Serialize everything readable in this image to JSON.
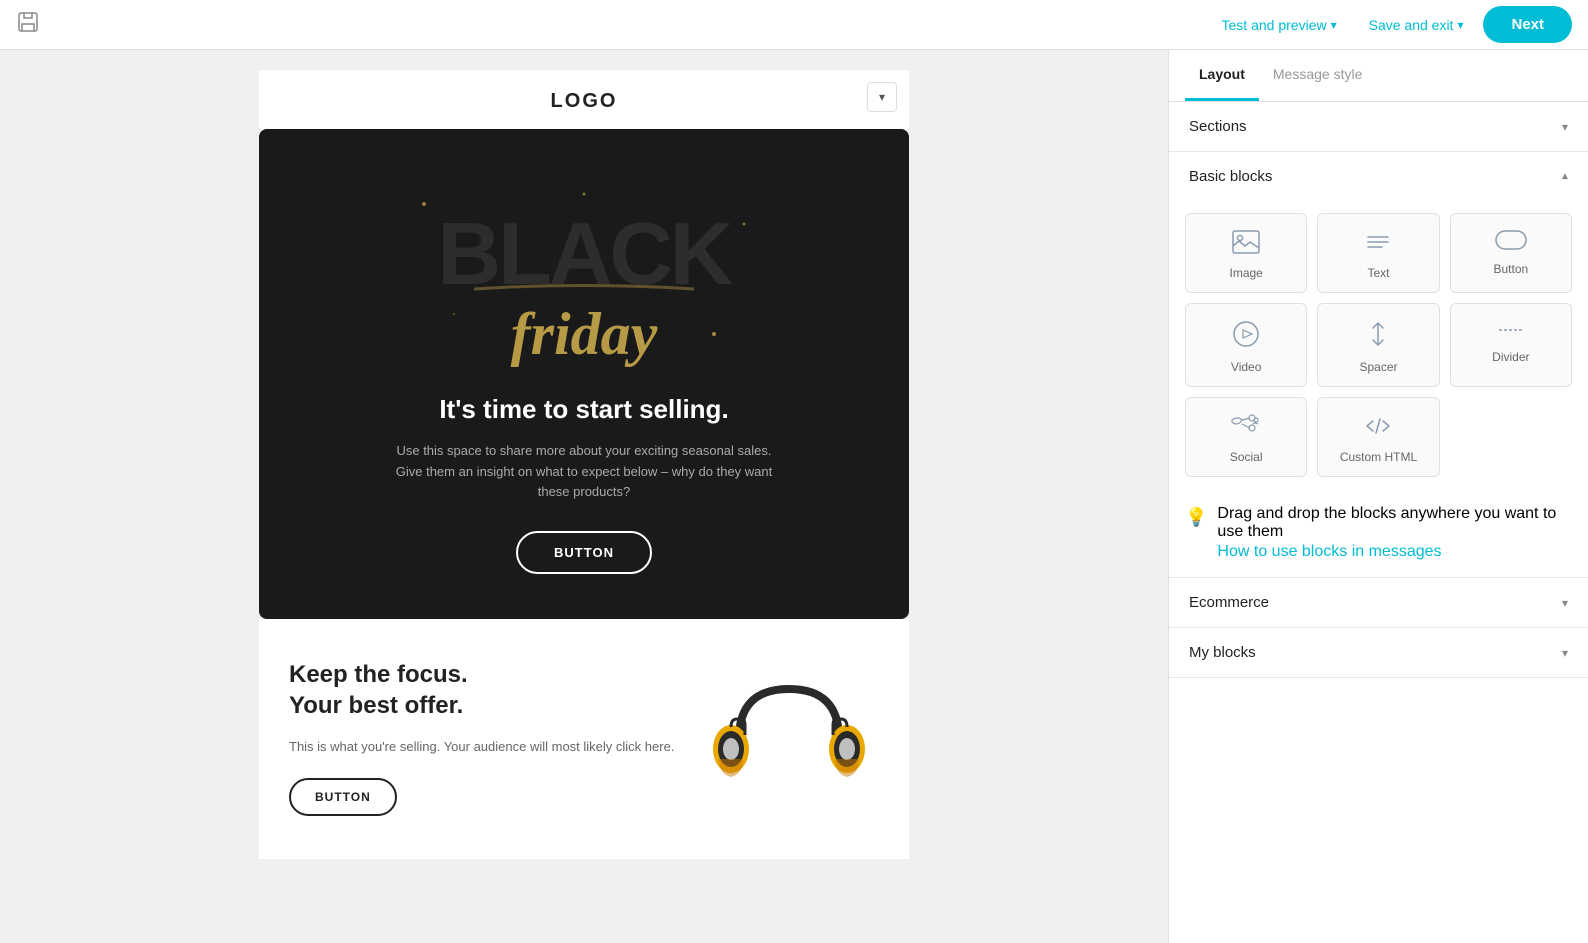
{
  "topbar": {
    "save_icon_label": "save",
    "test_preview_label": "Test and preview",
    "save_exit_label": "Save and exit",
    "next_label": "Next"
  },
  "canvas": {
    "logo_text": "LOGO",
    "collapse_icon": "▾",
    "hero": {
      "bf_black": "BLACK",
      "bf_gold": "friday",
      "headline": "It's time to start selling.",
      "subtext": "Use this space to share more about your exciting seasonal sales. Give them an insight on what to expect below – why do they want these products?",
      "button_label": "BUTTON"
    },
    "content": {
      "title_line1": "Keep the focus.",
      "title_line2": "Your best offer.",
      "description": "This is what you're selling. Your audience will most likely click here.",
      "button_label": "BUTTON"
    }
  },
  "right_panel": {
    "tabs": [
      {
        "label": "Layout",
        "active": true
      },
      {
        "label": "Message style",
        "active": false
      }
    ],
    "sections_label": "Sections",
    "basic_blocks_label": "Basic blocks",
    "ecommerce_label": "Ecommerce",
    "my_blocks_label": "My blocks",
    "blocks": [
      {
        "id": "image",
        "label": "Image",
        "icon": "🖼"
      },
      {
        "id": "text",
        "label": "Text",
        "icon": "≡"
      },
      {
        "id": "button",
        "label": "Button",
        "icon": "⬜"
      },
      {
        "id": "video",
        "label": "Video",
        "icon": "▶"
      },
      {
        "id": "spacer",
        "label": "Spacer",
        "icon": "↕"
      },
      {
        "id": "divider",
        "label": "Divider",
        "icon": "—"
      },
      {
        "id": "social",
        "label": "Social",
        "icon": "🐦"
      },
      {
        "id": "custom-html",
        "label": "Custom HTML",
        "icon": "</>"
      }
    ],
    "drag_hint": "Drag and drop the blocks anywhere you want to use them",
    "drag_hint_link": "How to use blocks in messages"
  }
}
